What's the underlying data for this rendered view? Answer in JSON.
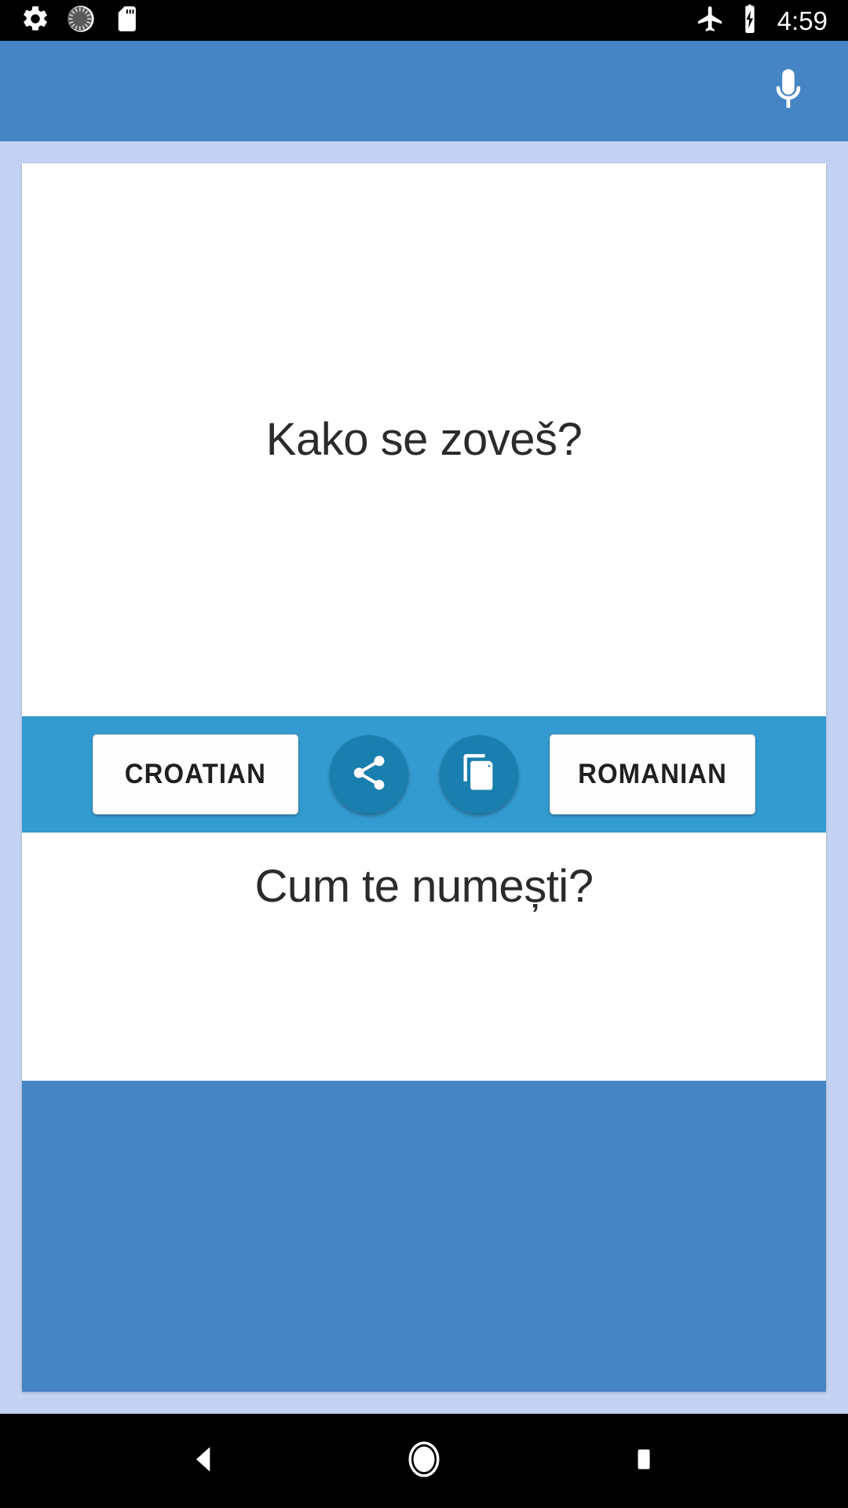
{
  "status_bar": {
    "icons_left": [
      "gear-icon",
      "sync-circle-icon",
      "sd-card-icon"
    ],
    "icons_right": [
      "airplane-mode-icon",
      "battery-charging-icon"
    ],
    "time": "4:59"
  },
  "app_bar": {
    "mic_icon": "microphone-icon",
    "background_color": "#4585c4"
  },
  "translator": {
    "source_text": "Kako se zoveš?",
    "target_text": "Cum te numești?",
    "source_language_label": "CROATIAN",
    "target_language_label": "ROMANIAN",
    "share_icon": "share-icon",
    "copy_icon": "copy-icon",
    "toolbar_color": "#339bd0",
    "fab_color": "#1a7fae"
  },
  "nav_bar": {
    "back_label": "back-icon",
    "home_label": "home-icon",
    "recents_label": "recents-icon"
  }
}
